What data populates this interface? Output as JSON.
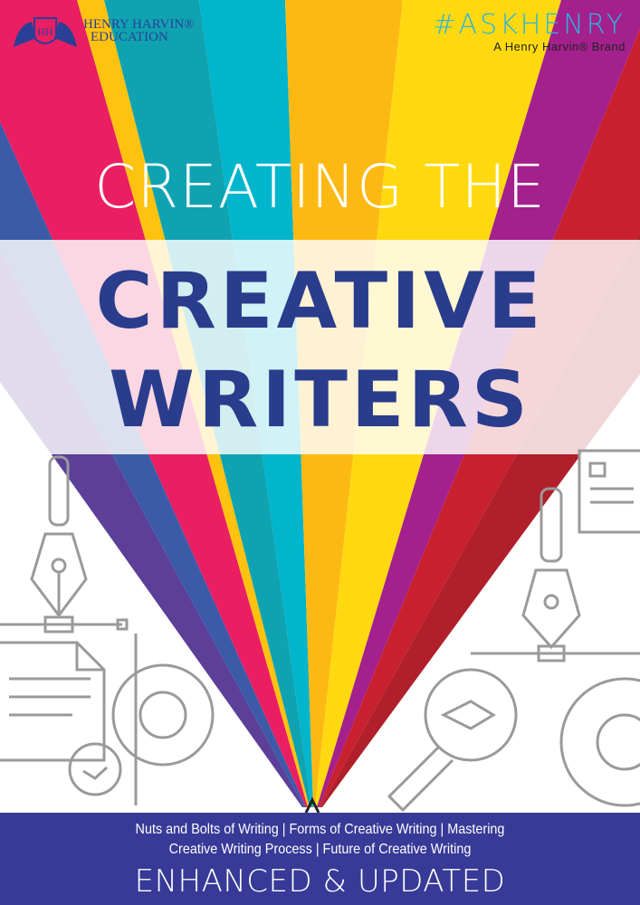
{
  "cover": {
    "publisher_logo": {
      "line1": "HENRY HARVIN®",
      "line2": "EDUCATION",
      "monogram": "HH"
    },
    "brand": {
      "hashtag": "#ASKHENRY",
      "tagline": "A Henry Harvin® Brand"
    },
    "title": {
      "line1": "CREATING THE",
      "line2": "CREATIVE",
      "line3": "WRITERS"
    },
    "topics_line1": "Nuts and Bolts of Writing | Forms of Creative Writing | Mastering",
    "topics_line2": "Creative Writing Process | Future of Creative Writing",
    "edition": "ENHANCED & UPDATED"
  },
  "colors": {
    "title_navy": "#2a3c8c",
    "bottom_band": "#373a97",
    "hashtag_blue": "#29b6e0",
    "rays": [
      "#5b3f98",
      "#3b5ba8",
      "#e91e63",
      "#ffc20e",
      "#0fa3b1",
      "#00b5cc",
      "#fdb913",
      "#ffd90f",
      "#a3208d",
      "#c8202f",
      "#b01f2a"
    ]
  },
  "icons": [
    "pen-nib-icon",
    "document-icon",
    "gear-icon",
    "clock-icon",
    "magnifier-pen-icon",
    "notepad-icon"
  ]
}
